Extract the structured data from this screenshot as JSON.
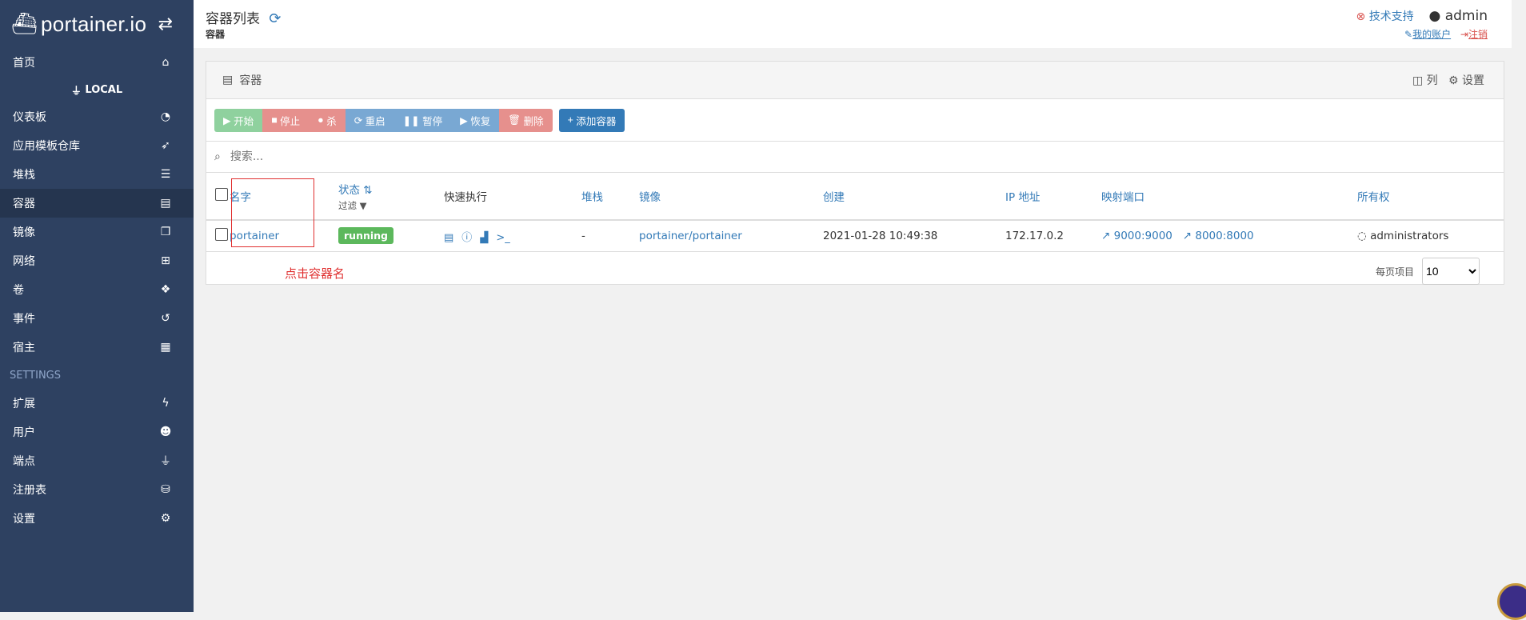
{
  "brand": {
    "name": "portainer.io"
  },
  "sidebar": {
    "items": [
      {
        "label": "首页",
        "icon": "home-icon"
      },
      {
        "label": "仪表板",
        "icon": "dashboard-icon"
      },
      {
        "label": "应用模板仓库",
        "icon": "rocket-icon"
      },
      {
        "label": "堆栈",
        "icon": "list-icon"
      },
      {
        "label": "容器",
        "icon": "server-icon"
      },
      {
        "label": "镜像",
        "icon": "clone-icon"
      },
      {
        "label": "网络",
        "icon": "sitemap-icon"
      },
      {
        "label": "卷",
        "icon": "cubes-icon"
      },
      {
        "label": "事件",
        "icon": "history-icon"
      },
      {
        "label": "宿主",
        "icon": "th-icon"
      }
    ],
    "local_label": "LOCAL",
    "settings_header": "SETTINGS",
    "settings_items": [
      {
        "label": "扩展",
        "icon": "bolt-icon"
      },
      {
        "label": "用户",
        "icon": "users-icon"
      },
      {
        "label": "端点",
        "icon": "plug-icon"
      },
      {
        "label": "注册表",
        "icon": "database-icon"
      },
      {
        "label": "设置",
        "icon": "cogs-icon"
      }
    ]
  },
  "header": {
    "title": "容器列表",
    "breadcrumb": "容器",
    "support": "技术支持",
    "user": "admin",
    "my_account": "我的账户",
    "logout": "注销"
  },
  "panel": {
    "title": "容器",
    "columns_label": "列",
    "settings_label": "设置",
    "actions": {
      "start": "开始",
      "stop": "停止",
      "kill": "杀",
      "restart": "重启",
      "pause": "暂停",
      "resume": "恢复",
      "remove": "删除",
      "add": "添加容器"
    },
    "search_placeholder": "搜索...",
    "headers": {
      "name": "名字",
      "state": "状态",
      "filter": "过滤",
      "quick_actions": "快速执行",
      "stack": "堆栈",
      "image": "镜像",
      "created": "创建",
      "ip": "IP 地址",
      "ports": "映射端口",
      "ownership": "所有权"
    },
    "rows": [
      {
        "name": "portainer",
        "state": "running",
        "stack": "-",
        "image": "portainer/portainer",
        "created": "2021-01-28 10:49:38",
        "ip": "172.17.0.2",
        "port1": "9000:9000",
        "port2": "8000:8000",
        "ownership": "administrators"
      }
    ],
    "per_page_label": "每页项目",
    "per_page_value": "10"
  },
  "annotation": {
    "text": "点击容器名",
    "color": "#e03030"
  }
}
